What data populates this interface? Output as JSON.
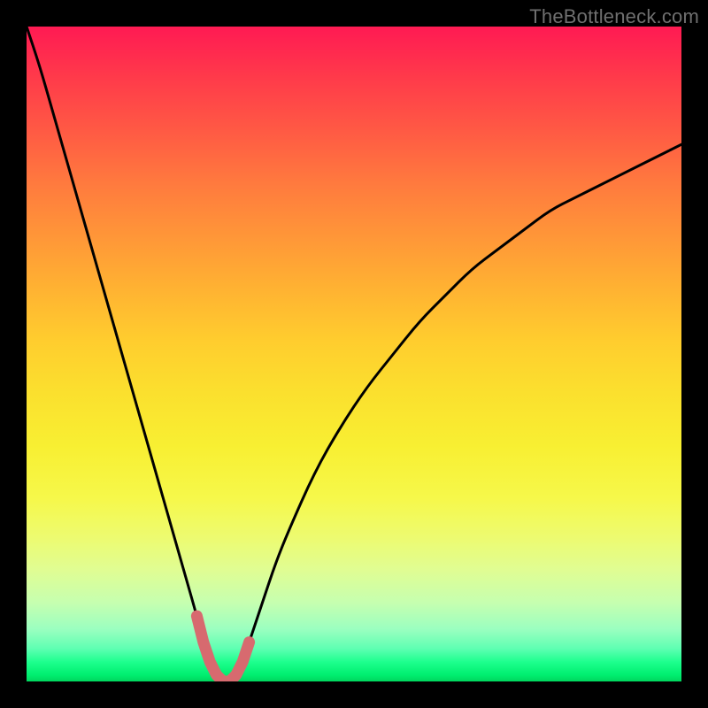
{
  "watermark": "TheBottleneck.com",
  "colors": {
    "frame": "#000000",
    "curve_stroke": "#000000",
    "curve_highlight": "#d76a6f",
    "gradient_top": "#ff1a53",
    "gradient_bottom": "#00d65d"
  },
  "chart_data": {
    "type": "line",
    "title": "",
    "xlabel": "",
    "ylabel": "",
    "xlim": [
      0,
      100
    ],
    "ylim": [
      0,
      100
    ],
    "x": [
      0,
      2,
      4,
      6,
      8,
      10,
      12,
      14,
      16,
      18,
      20,
      22,
      24,
      26,
      27,
      28,
      29,
      30,
      31,
      32,
      33,
      34,
      36,
      38,
      40,
      44,
      48,
      52,
      56,
      60,
      64,
      68,
      72,
      76,
      80,
      84,
      88,
      92,
      96,
      100
    ],
    "values": [
      100,
      94,
      87,
      80,
      73,
      66,
      59,
      52,
      45,
      38,
      31,
      24,
      17,
      10,
      6,
      3,
      1,
      0,
      0,
      1,
      3,
      6,
      12,
      18,
      23,
      32,
      39,
      45,
      50,
      55,
      59,
      63,
      66,
      69,
      72,
      74,
      76,
      78,
      80,
      82
    ],
    "highlight_range_x": [
      26,
      34
    ],
    "curve_minimum_x": 30.5
  }
}
